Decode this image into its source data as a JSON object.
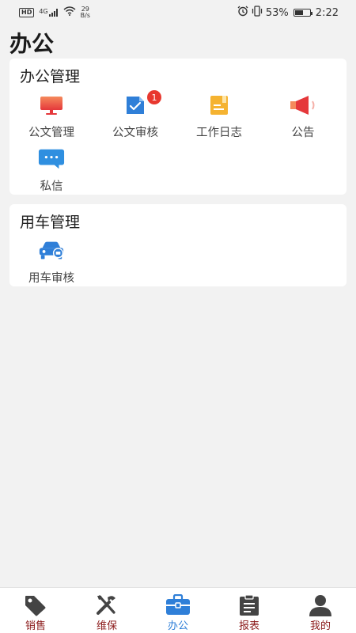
{
  "status_bar": {
    "hd": "HD",
    "network": "4G",
    "speed_value": "29",
    "speed_unit": "B/s",
    "battery": "53%",
    "time": "2:22"
  },
  "page": {
    "title": "办公"
  },
  "office_section": {
    "title": "办公管理",
    "items": [
      {
        "label": "公文管理",
        "icon": "monitor-icon"
      },
      {
        "label": "公文审核",
        "icon": "document-check-icon",
        "badge": "1"
      },
      {
        "label": "工作日志",
        "icon": "notebook-icon"
      },
      {
        "label": "公告",
        "icon": "megaphone-icon"
      },
      {
        "label": "私信",
        "icon": "chat-bubble-icon"
      }
    ]
  },
  "car_section": {
    "title": "用车管理",
    "items": [
      {
        "label": "用车审核",
        "icon": "car-icon"
      }
    ]
  },
  "bottom_nav": {
    "items": [
      {
        "label": "销售",
        "icon": "tag-icon"
      },
      {
        "label": "维保",
        "icon": "tools-icon"
      },
      {
        "label": "办公",
        "icon": "briefcase-icon",
        "active": true
      },
      {
        "label": "报表",
        "icon": "clipboard-icon"
      },
      {
        "label": "我的",
        "icon": "person-icon"
      }
    ]
  },
  "colors": {
    "accent": "#2f7fd8",
    "nav_inactive": "#8b1a1a",
    "badge": "#e8382f"
  }
}
